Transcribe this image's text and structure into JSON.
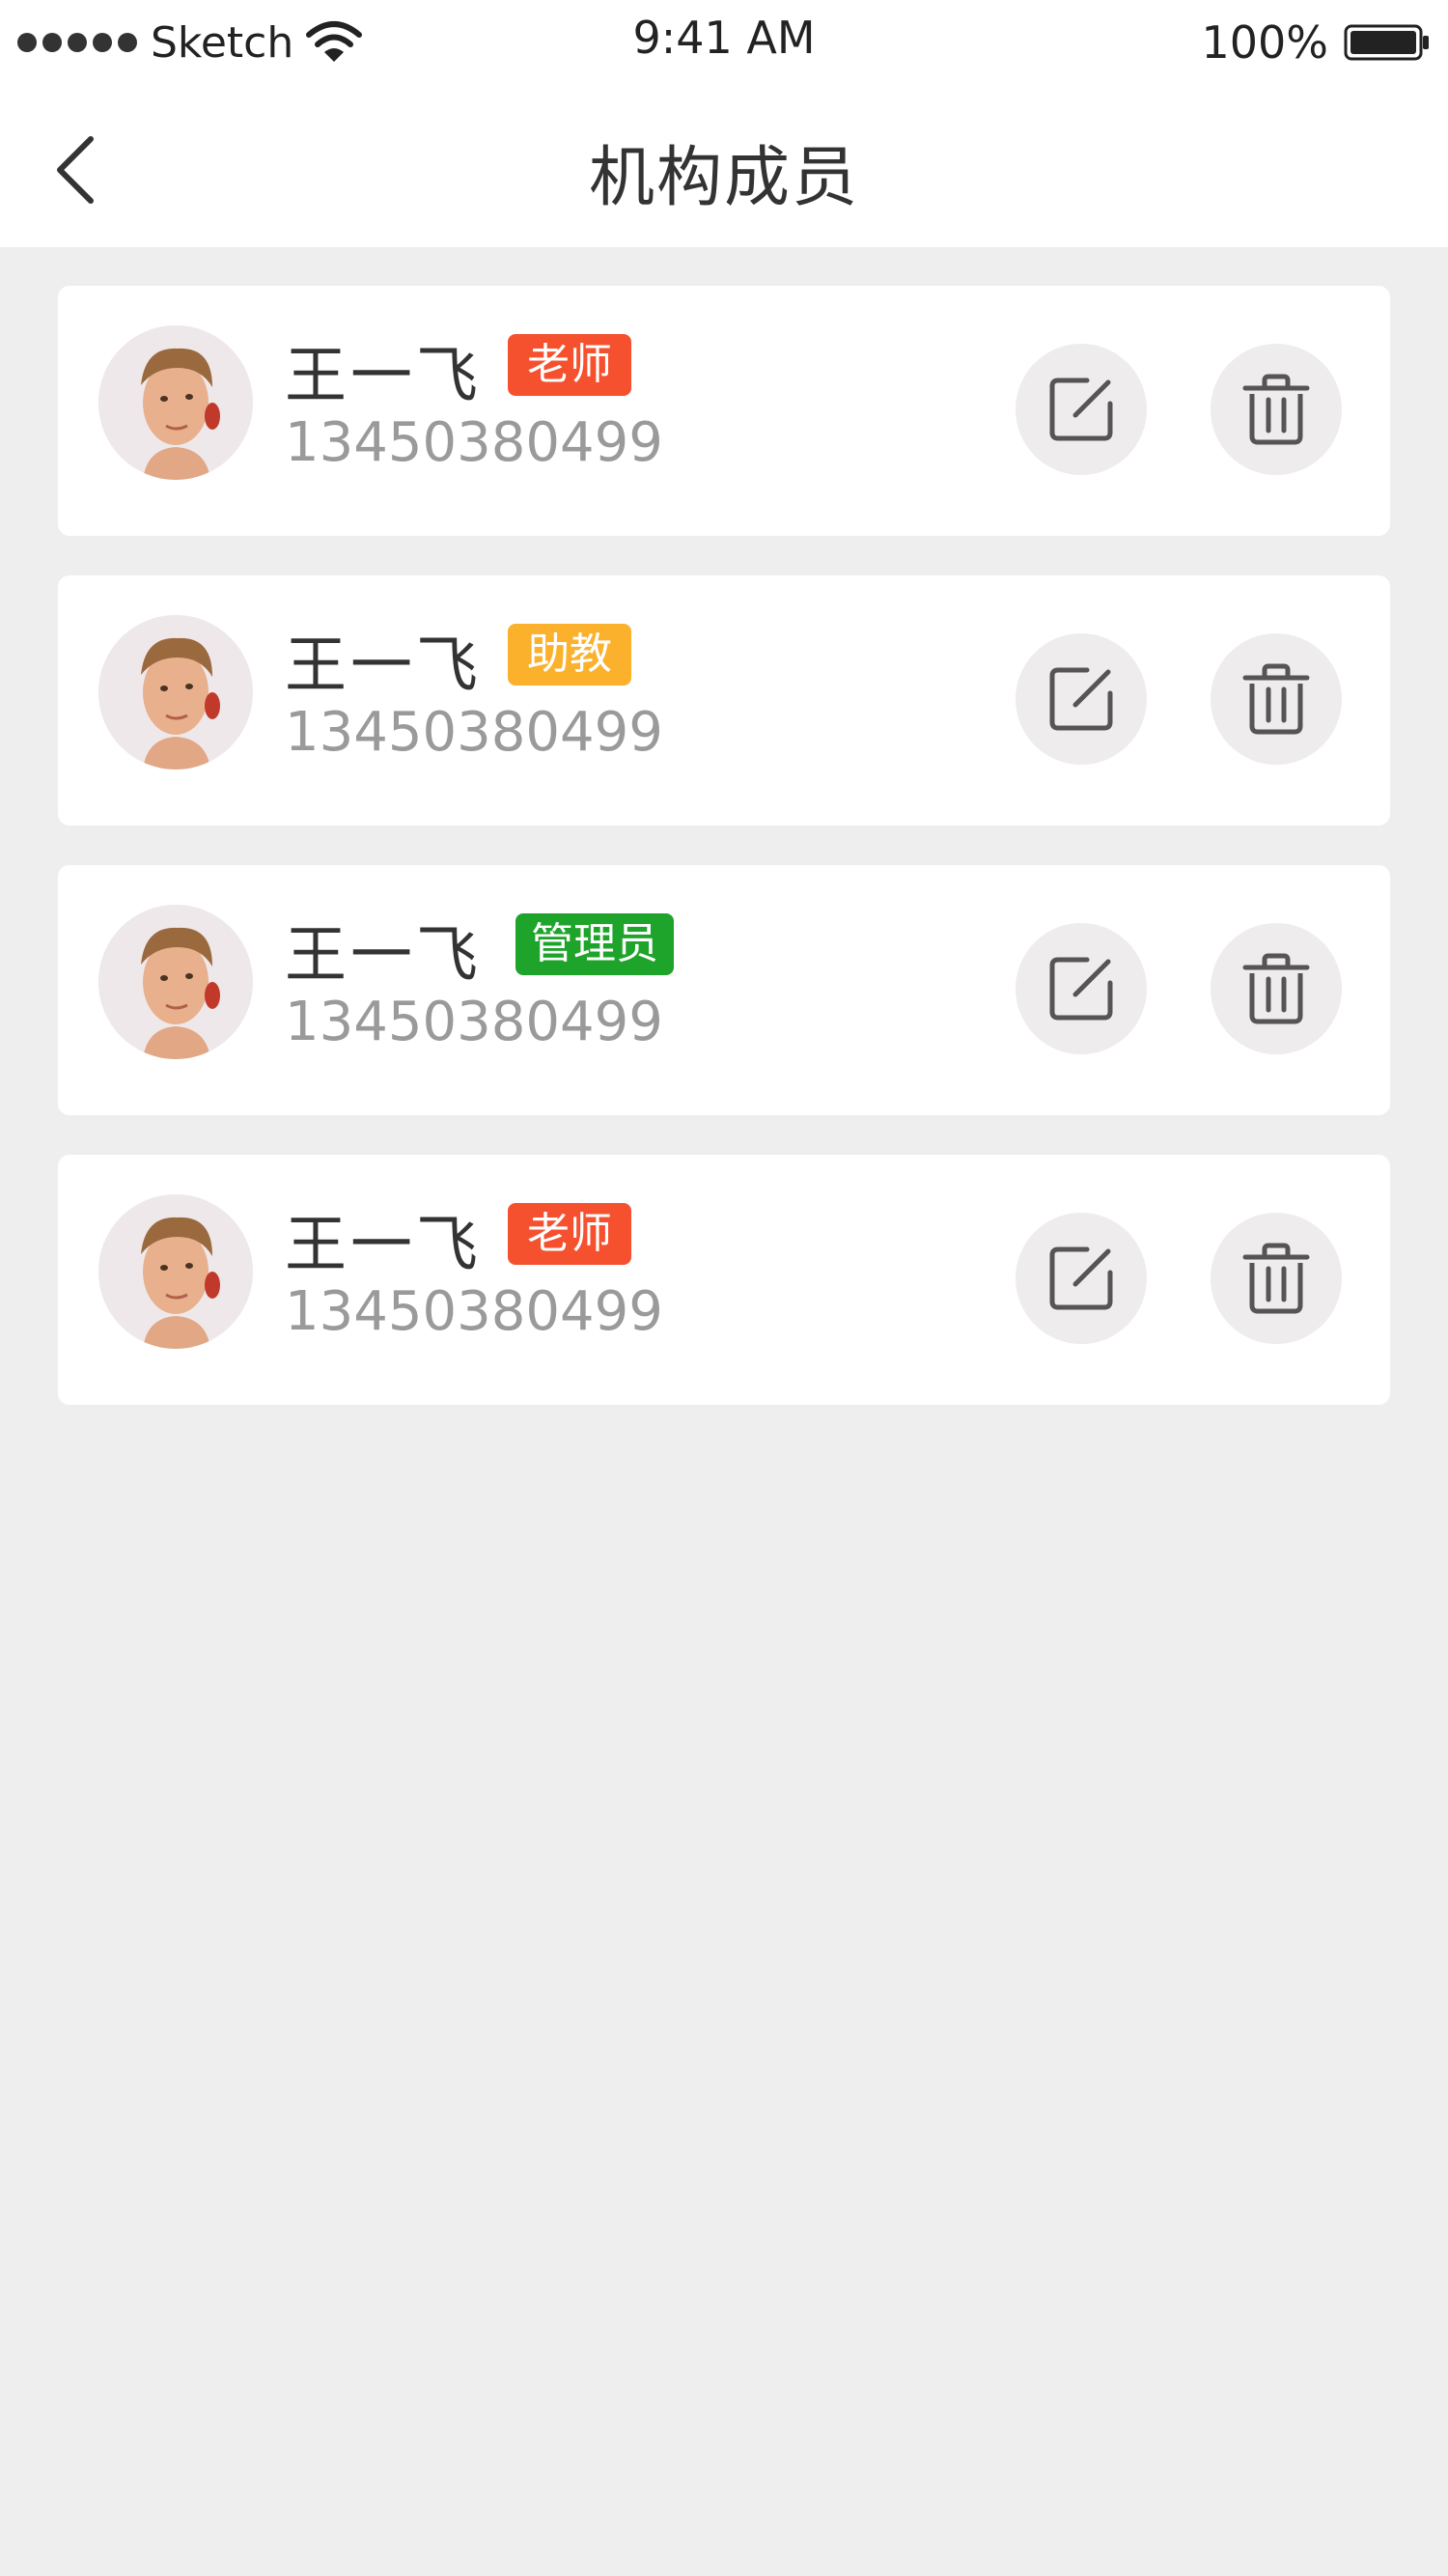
{
  "status_bar": {
    "carrier": "Sketch",
    "time": "9:41 AM",
    "battery": "100%"
  },
  "nav": {
    "title": "机构成员",
    "back_icon": "chevron-left-icon"
  },
  "colors": {
    "teacher": "#f5512f",
    "assistant": "#fbb12b",
    "admin": "#1ea42a",
    "background": "#eeeeee"
  },
  "members": [
    {
      "name": "王一飞",
      "role": "老师",
      "role_color": "#f5512f",
      "phone": "13450380499"
    },
    {
      "name": "王一飞",
      "role": "助教",
      "role_color": "#fbb12b",
      "phone": "13450380499"
    },
    {
      "name": "王一飞",
      "role": "管理员",
      "role_color": "#1ea42a",
      "phone": "13450380499"
    },
    {
      "name": "王一飞",
      "role": "老师",
      "role_color": "#f5512f",
      "phone": "13450380499"
    }
  ]
}
